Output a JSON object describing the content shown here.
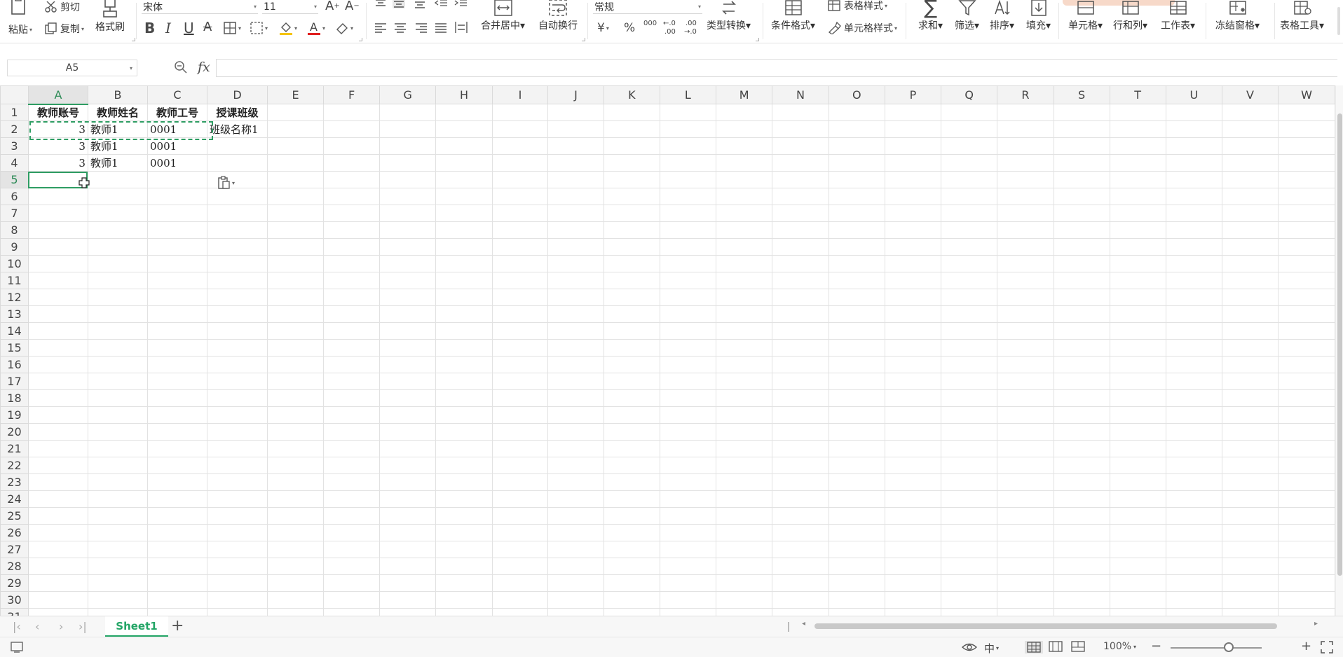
{
  "ribbon": {
    "paste": "粘贴",
    "cut": "剪切",
    "copy": "复制",
    "format_painter": "格式刷",
    "font_name": "宋体",
    "font_size": "11",
    "merge_center": "合并居中",
    "wrap_text": "自动换行",
    "number_format": "常规",
    "currency_symbol": "¥",
    "percent_symbol": "%",
    "type_convert": "类型转换",
    "conditional_format": "条件格式",
    "table_style": "表格样式",
    "cell_style": "单元格样式",
    "sum": "求和",
    "filter": "筛选",
    "sort": "排序",
    "fill": "填充",
    "cell": "单元格",
    "row_col": "行和列",
    "worksheet": "工作表",
    "freeze": "冻结窗格",
    "table_tools": "表格工具"
  },
  "formula_bar": {
    "name_box": "A5",
    "fx": "fx",
    "formula": ""
  },
  "grid": {
    "columns": [
      "A",
      "B",
      "C",
      "D",
      "E",
      "F",
      "G",
      "H",
      "I",
      "J",
      "K",
      "L",
      "M",
      "N",
      "O",
      "P",
      "Q",
      "R",
      "S",
      "T",
      "U",
      "V",
      "W"
    ],
    "selected_column": "A",
    "selected_row": 5,
    "row_count": 31,
    "cells": {
      "A1": "教师账号",
      "B1": "教师姓名",
      "C1": "教师工号",
      "D1": "授课班级",
      "A2": "3",
      "B2": "教师1",
      "C2": "0001",
      "D2": "班级名称1",
      "A3": "3",
      "B3": "教师1",
      "C3": "0001",
      "A4": "3",
      "B4": "教师1",
      "C4": "0001"
    }
  },
  "sheets": {
    "active": "Sheet1",
    "add_label": "+"
  },
  "status": {
    "zoom": "100%"
  },
  "colors": {
    "accent": "#23a566",
    "selection": "#2e9d63",
    "header_bg": "#f3f3f3"
  }
}
